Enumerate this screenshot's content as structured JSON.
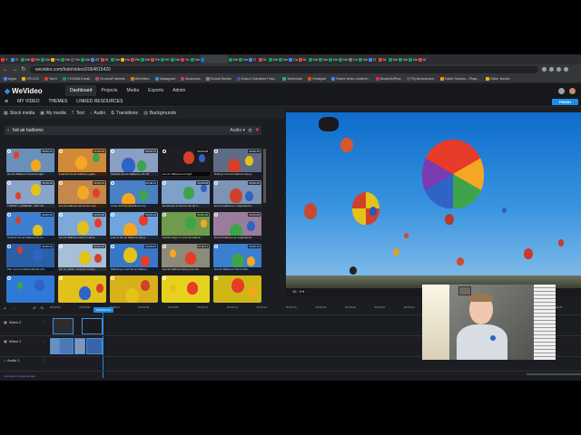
{
  "browser": {
    "tabs": [
      "Y",
      "S",
      "Ne",
      "Re",
      "Ne",
      "Ho",
      "Ne",
      "Se",
      "Ne",
      "AT",
      "M",
      "Ne",
      "Ho",
      "Re",
      "Ne",
      "Re",
      "90",
      "Ne",
      "Yo",
      "Ne",
      "",
      "Ne",
      "Ne",
      "G",
      "M",
      "Ne",
      "Ne",
      "Ca",
      "M",
      "Ne",
      "Ne",
      "Ne",
      "Ne",
      "Ce",
      "Ne",
      "G",
      "M",
      "Ne",
      "Ne",
      "Ne",
      "M"
    ],
    "tab_colors": [
      "#e33",
      "#4285f4",
      "#0f9d58",
      "#db4437",
      "#0f9d58",
      "#f4b400",
      "#0f9d58",
      "#555",
      "#0f9d58",
      "#4285f4",
      "#ea4335",
      "#0f9d58",
      "#f4b400",
      "#db4437",
      "#0f9d58",
      "#db4437",
      "#0f9d58",
      "#0f9d58",
      "#e33",
      "#0f9d58",
      "#1a73e8",
      "#0f9d58",
      "#0f9d58",
      "#4285f4",
      "#ea4335",
      "#0f9d58",
      "#0f9d58",
      "#4285f4",
      "#ea4335",
      "#0f9d58",
      "#0f9d58",
      "#0f9d58",
      "#0f9d58",
      "#777",
      "#0f9d58",
      "#4285f4",
      "#ea4335",
      "#0f9d58",
      "#0f9d58",
      "#0f9d58",
      "#ea4335"
    ],
    "url": "wevideo.com/hub#video/2064815420",
    "bookmarks": [
      "Apps",
      "XPLGO",
      "TeeX",
      "YOUNA Email",
      "GrooveFunnels",
      "WeVideo",
      "Instagram",
      "Business",
      "Social Media",
      "Grand Gardens Fest...",
      "Schedule",
      "Vidalyse",
      "Share texts content...",
      "BookVipPlus",
      "Fly Aerodrome",
      "Table Games - Playi...",
      "Other books"
    ]
  },
  "app": {
    "logo": "WeVideo",
    "nav": [
      "Dashboard",
      "Projects",
      "Media",
      "Exports",
      "Admin"
    ],
    "active_nav": "Dashboard",
    "project_items": [
      "MY VIDEO",
      "THEMES",
      "LINKED RESOURCES"
    ],
    "finish_label": "FINISH"
  },
  "media": {
    "tabs": [
      "Stock media",
      "My media",
      "Text",
      "Audio",
      "Transitions",
      "Backgrounds"
    ],
    "tab_icons": [
      "stock-media-icon",
      "my-media-icon",
      "text-icon",
      "audio-icon",
      "transitions-icon",
      "backgrounds-icon"
    ],
    "search_query": "hot air balloons",
    "filter_select": "Audio",
    "items": [
      {
        "caption": "Hot Air Balloons Float through...",
        "duration": "00:00:12",
        "bg": "#6a8fb8"
      },
      {
        "caption": "Colorful hot air balloons again...",
        "duration": "00:00:09",
        "bg": "#d18a3a"
      },
      {
        "caption": "Multiple Hot Air Balloons Lift Off",
        "duration": "00:00:14",
        "bg": "#8a9fc2"
      },
      {
        "caption": "Hot Air Balloons at Night",
        "duration": "00:00:08",
        "bg": "#1e1e24"
      },
      {
        "caption": "Riding in hot air balloons flying...",
        "duration": "00:00:15",
        "bg": "#5e6b85"
      },
      {
        "caption": "TURKEY, GOREME - MAY 20...",
        "duration": "00:00:10",
        "bg": "#8aa3c8"
      },
      {
        "caption": "Hot air balloons above the sea",
        "duration": "00:00:13",
        "bg": "#c4884c"
      },
      {
        "caption": "Close 360 hot air balloons fly...",
        "duration": "00:00:11",
        "bg": "#4a80c4"
      },
      {
        "caption": "Hundreds of colored hot air b...",
        "duration": "00:00:09",
        "bg": "#7fa0c8"
      },
      {
        "caption": "Hot air balloons in Cappadocia...",
        "duration": "00:00:12",
        "bg": "#7d94b6"
      },
      {
        "caption": "Colorful hot air balloons fly ov...",
        "duration": "00:00:10",
        "bg": "#3f7fd0"
      },
      {
        "caption": "Hot Air Balloons Above Hanoi...",
        "duration": "00:00:08",
        "bg": "#7da9d8"
      },
      {
        "caption": "Lots of hot air balloons flying...",
        "duration": "00:00:14",
        "bg": "#6fa4dc"
      },
      {
        "caption": "Aerial image of a hot air balloon...",
        "duration": "00:00:16",
        "bg": "#6e9b4e"
      },
      {
        "caption": "Hot air balloons at Cappadocia...",
        "duration": "00:00:09",
        "bg": "#9a7d9c"
      },
      {
        "caption": "Pan up to reveal hundreds of b...",
        "duration": "00:00:12",
        "bg": "#2b5fa8"
      },
      {
        "caption": "20, 11, 2019 - Goreme Turkey...",
        "duration": "00:00:10",
        "bg": "#a7bfd9"
      },
      {
        "caption": "Watching a red hot air balloon...",
        "duration": "00:00:07",
        "bg": "#3977c6"
      },
      {
        "caption": "Hot air balloons flying over De...",
        "duration": "00:00:11",
        "bg": "#8c8a78"
      },
      {
        "caption": "Hot Air Balloons Above Mou...",
        "duration": "00:00:13",
        "bg": "#3a7fd0"
      },
      {
        "caption": "",
        "duration": "",
        "bg": "#2f7ad8"
      },
      {
        "caption": "",
        "duration": "",
        "bg": "#e0c21a"
      },
      {
        "caption": "",
        "duration": "",
        "bg": "#d8b01a"
      },
      {
        "caption": "",
        "duration": "",
        "bg": "#e6d21c"
      },
      {
        "caption": "",
        "duration": "",
        "bg": "#cfb816"
      }
    ]
  },
  "preview": {
    "aspect": "16 : 9"
  },
  "timeline": {
    "playhead_time": "00:00:01:21",
    "ticks": [
      "00:00:00",
      "00:00:02",
      "00:00:04",
      "00:00:06",
      "00:00:08",
      "00:00:10",
      "00:00:12",
      "00:00:14",
      "00:00:16",
      "00:00:18",
      "00:00:20",
      "00:00:22",
      "00:00:24",
      "00:00:26",
      "00:00:28",
      "00:00:30",
      "00:00:32",
      "00:00:34"
    ],
    "tracks": [
      "Video 2",
      "Video 1",
      "Audio 1"
    ],
    "autosave": "Last saved 1 seconds ago"
  },
  "colors": {
    "accent": "#1d8ce6",
    "background": "#1b1d22"
  }
}
